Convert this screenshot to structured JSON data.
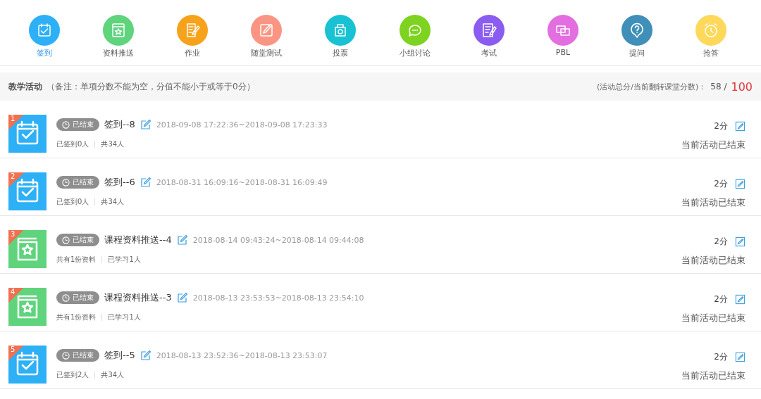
{
  "toolbar": [
    {
      "label": "签到",
      "kind": "sign",
      "color": "#2db0f5",
      "selected": true
    },
    {
      "label": "资料推送",
      "kind": "resource",
      "color": "#5fd47d",
      "selected": false
    },
    {
      "label": "作业",
      "kind": "homework",
      "color": "#f7a21b",
      "selected": false
    },
    {
      "label": "随堂测试",
      "kind": "quiz",
      "color": "#fb9583",
      "selected": false
    },
    {
      "label": "投票",
      "kind": "vote",
      "color": "#18c2d3",
      "selected": false
    },
    {
      "label": "小组讨论",
      "kind": "discuss",
      "color": "#7ed321",
      "selected": false
    },
    {
      "label": "考试",
      "kind": "exam",
      "color": "#8b5cf0",
      "selected": false
    },
    {
      "label": "PBL",
      "kind": "pbl",
      "color": "#e36ee0",
      "selected": false
    },
    {
      "label": "提问",
      "kind": "question",
      "color": "#3f8fb8",
      "selected": false
    },
    {
      "label": "抢答",
      "kind": "race",
      "color": "#fdd85b",
      "selected": false
    }
  ],
  "section": {
    "title": "教学活动",
    "note": "（备注：单项分数不能为空，分值不能小于或等于0分）",
    "score_label": "(活动总分/当前翻转课堂分数)：",
    "score": "58 /",
    "total": "100"
  },
  "activities": [
    {
      "index": "1",
      "kind": "sign",
      "status": "已结束",
      "title": "签到--8",
      "time": "2018-09-08 17:22:36~2018-09-08 17:23:33",
      "stats": [
        "已签到0人",
        "共34人"
      ],
      "score": "2分",
      "state": "当前活动已结束"
    },
    {
      "index": "2",
      "kind": "sign",
      "status": "已结束",
      "title": "签到--6",
      "time": "2018-08-31 16:09:16~2018-08-31 16:09:49",
      "stats": [
        "已签到0人",
        "共34人"
      ],
      "score": "2分",
      "state": "当前活动已结束"
    },
    {
      "index": "3",
      "kind": "resource",
      "status": "已结束",
      "title": "课程资料推送--4",
      "time": "2018-08-14 09:43:24~2018-08-14 09:44:08",
      "stats": [
        "共有1份资料",
        "已学习1人"
      ],
      "score": "2分",
      "state": "当前活动已结束"
    },
    {
      "index": "4",
      "kind": "resource",
      "status": "已结束",
      "title": "课程资料推送--3",
      "time": "2018-08-13 23:53:53~2018-08-13 23:54:10",
      "stats": [
        "共有1份资料",
        "已学习1人"
      ],
      "score": "2分",
      "state": "当前活动已结束"
    },
    {
      "index": "5",
      "kind": "sign",
      "status": "已结束",
      "title": "签到--5",
      "time": "2018-08-13 23:52:36~2018-08-13 23:53:07",
      "stats": [
        "已签到2人",
        "共34人"
      ],
      "score": "2分",
      "state": "当前活动已结束"
    }
  ]
}
